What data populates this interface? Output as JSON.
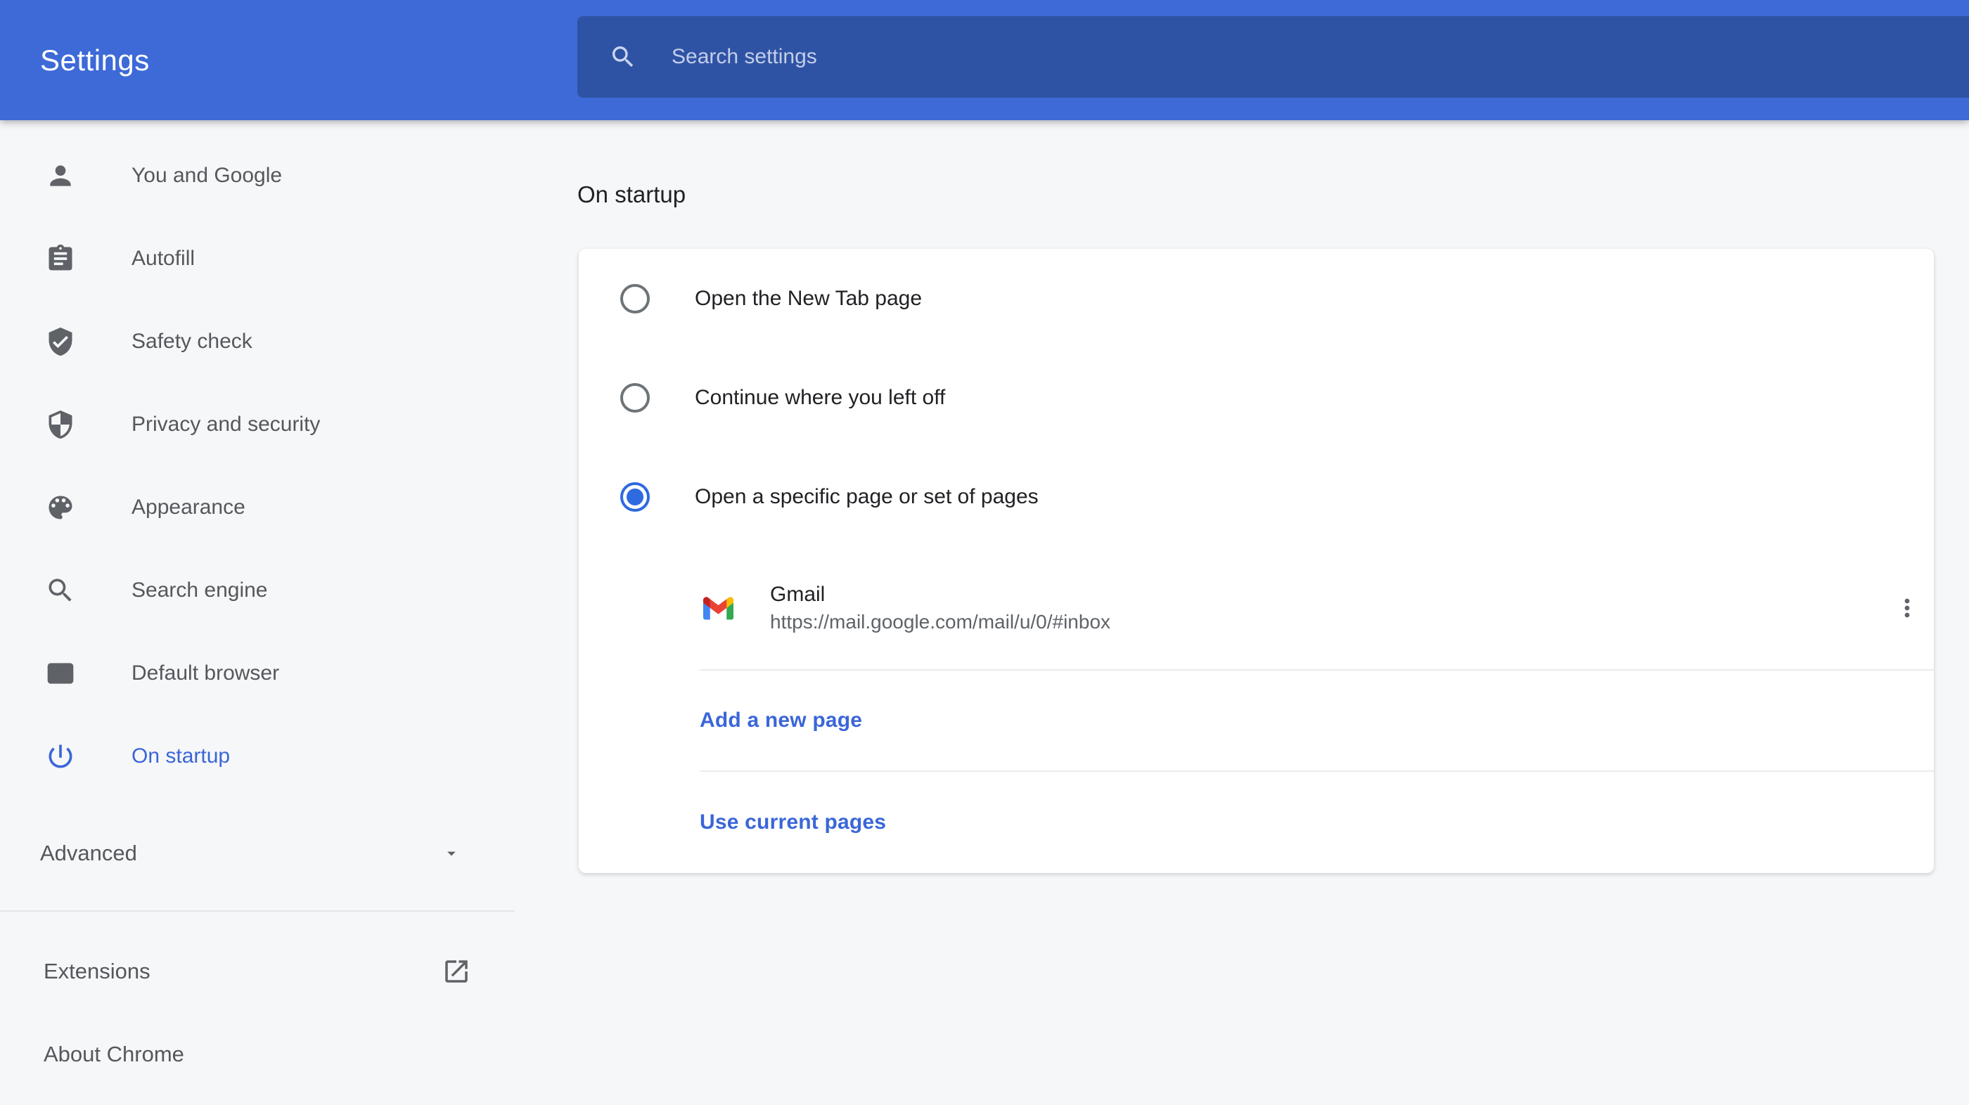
{
  "header": {
    "title": "Settings",
    "search_placeholder": "Search settings"
  },
  "sidebar": {
    "items": [
      {
        "label": "You and Google",
        "icon": "person-icon",
        "selected": false
      },
      {
        "label": "Autofill",
        "icon": "clipboard-icon",
        "selected": false
      },
      {
        "label": "Safety check",
        "icon": "shield-check-icon",
        "selected": false
      },
      {
        "label": "Privacy and security",
        "icon": "shield-half-icon",
        "selected": false
      },
      {
        "label": "Appearance",
        "icon": "palette-icon",
        "selected": false
      },
      {
        "label": "Search engine",
        "icon": "search-icon",
        "selected": false
      },
      {
        "label": "Default browser",
        "icon": "browser-window-icon",
        "selected": false
      },
      {
        "label": "On startup",
        "icon": "power-icon",
        "selected": true
      }
    ],
    "advanced_label": "Advanced",
    "footer_items": [
      {
        "label": "Extensions",
        "icon": "open-in-new-icon"
      },
      {
        "label": "About Chrome",
        "icon": ""
      }
    ]
  },
  "main": {
    "section_title": "On startup",
    "options": [
      {
        "label": "Open the New Tab page",
        "selected": false
      },
      {
        "label": "Continue where you left off",
        "selected": false
      },
      {
        "label": "Open a specific page or set of pages",
        "selected": true
      }
    ],
    "pages": [
      {
        "title": "Gmail",
        "url": "https://mail.google.com/mail/u/0/#inbox",
        "icon": "gmail-logo"
      }
    ],
    "add_page_label": "Add a new page",
    "use_current_label": "Use current pages"
  },
  "colors": {
    "header_bg": "#3D6AD7",
    "search_bg": "#2F53A4",
    "accent": "#3A66D8",
    "radio_accent": "#2E6AE0",
    "icon_gray": "#5F6368",
    "text_dark": "#202124",
    "text_gray": "#5F6368",
    "bg": "#F6F7F8",
    "card": "#FFFFFF",
    "divider": "#EAEBED",
    "placeholder": "#C3CEEA",
    "gmail_blue": "#4285F4",
    "gmail_red": "#EA4335",
    "gmail_green": "#34A853",
    "gmail_yellow": "#FBBC04",
    "gmail_dark_red": "#C5221F"
  }
}
